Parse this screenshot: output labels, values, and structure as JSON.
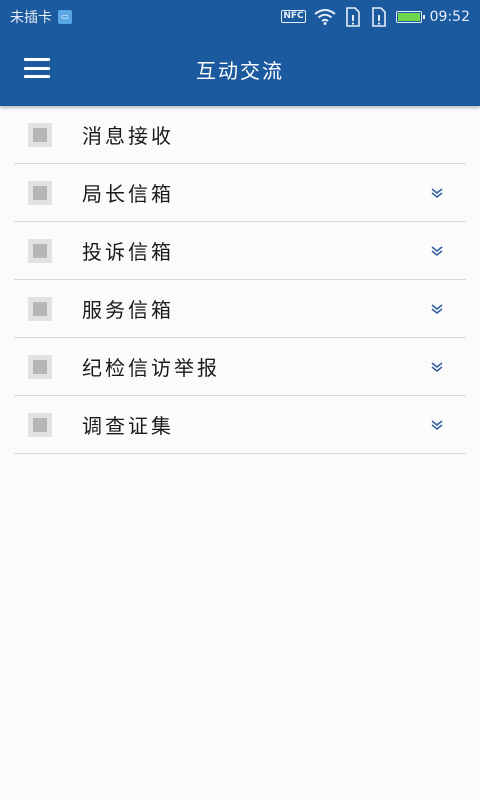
{
  "status_bar": {
    "carrier": "未插卡",
    "sim_icon": "sim-card-icon",
    "nfc": "NFC",
    "time": "09:52"
  },
  "app_bar": {
    "title": "互动交流",
    "menu_icon": "hamburger-menu-icon"
  },
  "menu": {
    "items": [
      {
        "label": "消息接收",
        "expandable": false
      },
      {
        "label": "局长信箱",
        "expandable": true
      },
      {
        "label": "投诉信箱",
        "expandable": true
      },
      {
        "label": "服务信箱",
        "expandable": true
      },
      {
        "label": "纪检信访举报",
        "expandable": true
      },
      {
        "label": "调查证集",
        "expandable": true
      }
    ]
  },
  "colors": {
    "primary": "#1c5aa0",
    "chevron": "#2f5f9e",
    "divider": "#d9d9d9",
    "background": "#fbfbfb"
  }
}
